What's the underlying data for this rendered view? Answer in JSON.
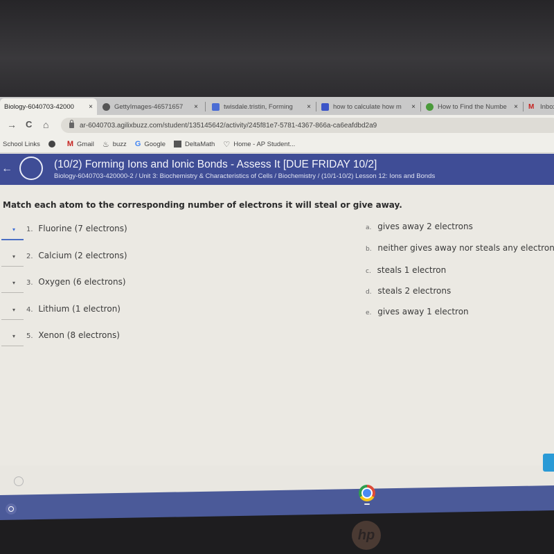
{
  "browser": {
    "tabs": [
      {
        "label": "Biology-6040703-42000",
        "icon": "agilix-icon",
        "active": true
      },
      {
        "label": "GettyImages-46571657",
        "icon": "globe-icon",
        "active": false
      },
      {
        "label": "twisdale.tristin, Forming",
        "icon": "docs-icon",
        "active": false
      },
      {
        "label": "how to calculate how m",
        "icon": "brainly-icon",
        "active": false
      },
      {
        "label": "How to Find the Numbe",
        "icon": "green-circle-icon",
        "active": false
      },
      {
        "label": "Inbox",
        "icon": "gmail-icon",
        "active": false
      }
    ],
    "close_glyph": "×",
    "nav": {
      "forward": "→",
      "reload": "C",
      "home": "⌂"
    },
    "url": "ar-6040703.agilixbuzz.com/student/135145642/activity/245f81e7-5781-4367-866a-ca6eafdbd2a9",
    "bookmarks": [
      {
        "label": "School Links",
        "icon": ""
      },
      {
        "label": "",
        "icon": "globe-icon"
      },
      {
        "label": "Gmail",
        "icon": "gmail-icon"
      },
      {
        "label": "buzz",
        "icon": "buzz-icon"
      },
      {
        "label": "Google",
        "icon": "google-icon"
      },
      {
        "label": "DeltaMath",
        "icon": "deltamath-icon"
      },
      {
        "label": "Home - AP Student...",
        "icon": "ap-icon"
      }
    ]
  },
  "header": {
    "back_glyph": "←",
    "title": "(10/2) Forming Ions and Ionic Bonds - Assess It [DUE FRIDAY 10/2]",
    "breadcrumb": "Biology-6040703-420000-2 / Unit 3: Biochemistry & Characteristics of Cells / Biochemistry / (10/1-10/2) Lesson 12: Ions and Bonds"
  },
  "question": {
    "instruction": "Match each atom to the corresponding number of electrons it will steal or give away.",
    "items": [
      {
        "num": "1.",
        "text": "Fluorine (7 electrons)",
        "selected": ""
      },
      {
        "num": "2.",
        "text": "Calcium (2 electrons)",
        "selected": ""
      },
      {
        "num": "3.",
        "text": "Oxygen (6 electrons)",
        "selected": ""
      },
      {
        "num": "4.",
        "text": "Lithium (1 electron)",
        "selected": ""
      },
      {
        "num": "5.",
        "text": "Xenon (8 electrons)",
        "selected": ""
      }
    ],
    "options": [
      {
        "letter": "a.",
        "text": "gives away 2 electrons"
      },
      {
        "letter": "b.",
        "text": "neither gives away nor steals any electrons"
      },
      {
        "letter": "c.",
        "text": "steals 1 electron"
      },
      {
        "letter": "d.",
        "text": "steals 2 electrons"
      },
      {
        "letter": "e.",
        "text": "gives away 1 electron"
      }
    ],
    "caret_glyph": "▾"
  },
  "colors": {
    "header_bg": "#3f4d96",
    "shelf_bg": "#4b5a99",
    "active_select": "#4a6fc3",
    "next_button": "#2a9ad6"
  },
  "device": {
    "brand": "hp"
  }
}
